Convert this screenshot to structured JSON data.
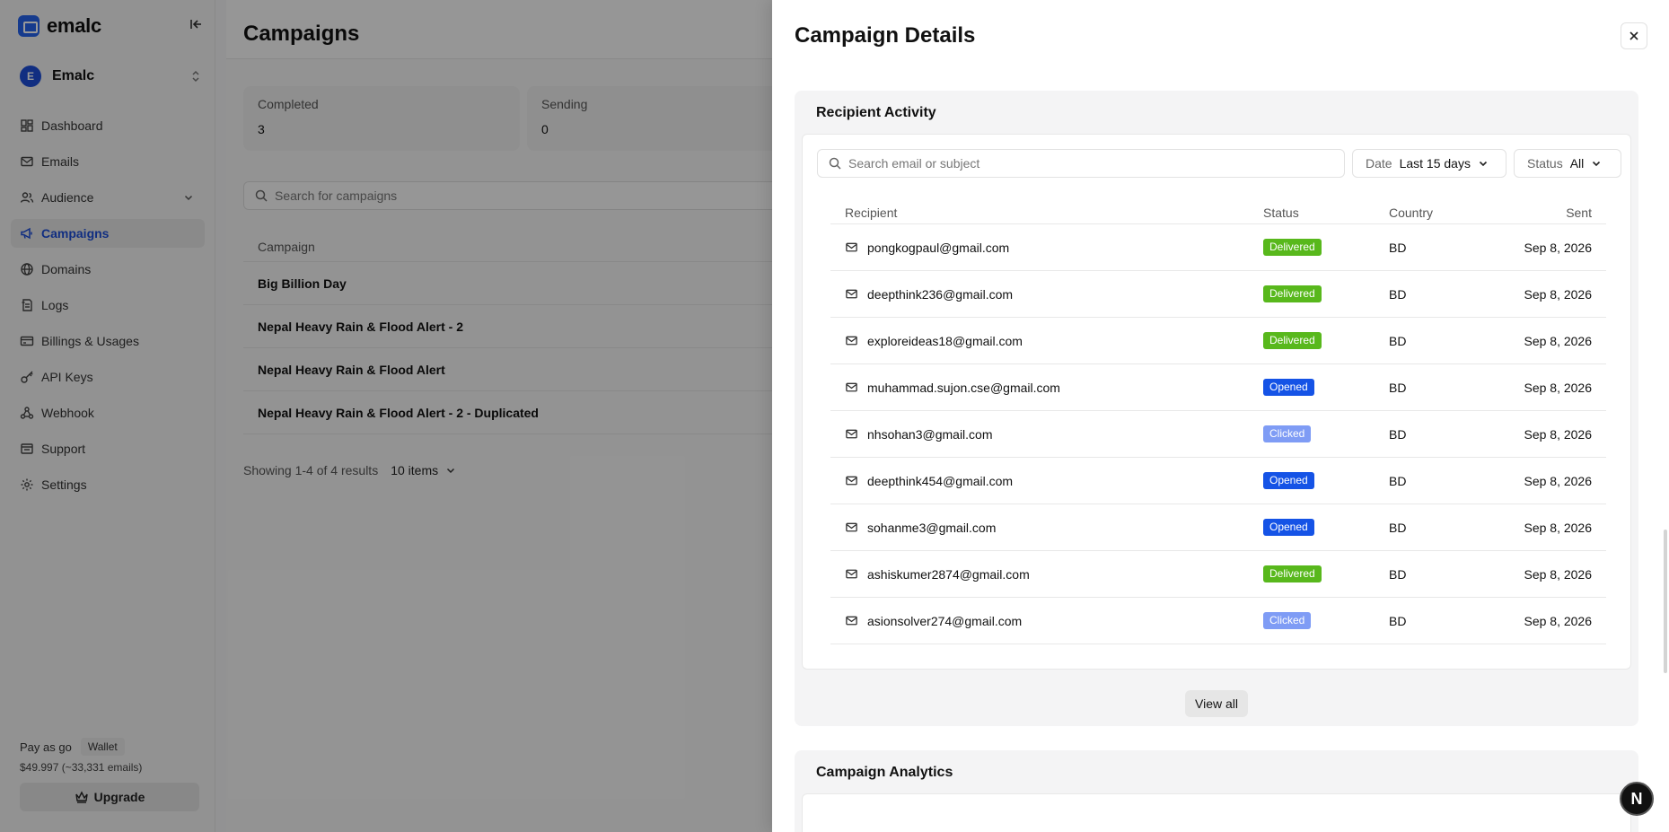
{
  "app": {
    "brand_name": "emalc",
    "org_name": "Emalc",
    "org_initial": "E"
  },
  "sidebar": {
    "items": [
      {
        "label": "Dashboard",
        "icon": "dashboard-icon"
      },
      {
        "label": "Emails",
        "icon": "mail-icon"
      },
      {
        "label": "Audience",
        "icon": "users-icon"
      },
      {
        "label": "Campaigns",
        "icon": "megaphone-icon",
        "active": true
      },
      {
        "label": "Domains",
        "icon": "globe-icon"
      },
      {
        "label": "Logs",
        "icon": "logs-icon"
      },
      {
        "label": "Billings & Usages",
        "icon": "credit-card-icon"
      },
      {
        "label": "API Keys",
        "icon": "key-icon"
      },
      {
        "label": "Webhook",
        "icon": "webhook-icon"
      },
      {
        "label": "Support",
        "icon": "support-icon"
      },
      {
        "label": "Settings",
        "icon": "gear-icon"
      }
    ],
    "plan_label": "Pay as go",
    "wallet_label": "Wallet",
    "balance": "$49.997 (~33,331 emails)",
    "upgrade_label": "Upgrade"
  },
  "main": {
    "title": "Campaigns",
    "stats": [
      {
        "label": "Completed",
        "value": "3"
      },
      {
        "label": "Sending",
        "value": "0"
      }
    ],
    "search_placeholder": "Search for campaigns",
    "table_header": "Campaign",
    "campaigns": [
      "Big Billion Day",
      "Nepal Heavy Rain & Flood Alert - 2",
      "Nepal Heavy Rain & Flood Alert",
      "Nepal Heavy Rain & Flood Alert - 2 - Duplicated"
    ],
    "showing": "Showing 1-4 of 4 results",
    "page_size": "10 items"
  },
  "drawer": {
    "title": "Campaign Details",
    "activity": {
      "title": "Recipient Activity",
      "search_placeholder": "Search email or subject",
      "date_label": "Date",
      "date_value": "Last 15 days",
      "status_label": "Status",
      "status_value": "All",
      "columns": {
        "recipient": "Recipient",
        "status": "Status",
        "country": "Country",
        "sent": "Sent"
      },
      "rows": [
        {
          "email": "pongkogpaul@gmail.com",
          "status": "Delivered",
          "country": "BD",
          "sent": "Sep 8, 2026"
        },
        {
          "email": "deepthink236@gmail.com",
          "status": "Delivered",
          "country": "BD",
          "sent": "Sep 8, 2026"
        },
        {
          "email": "exploreideas18@gmail.com",
          "status": "Delivered",
          "country": "BD",
          "sent": "Sep 8, 2026"
        },
        {
          "email": "muhammad.sujon.cse@gmail.com",
          "status": "Opened",
          "country": "BD",
          "sent": "Sep 8, 2026"
        },
        {
          "email": "nhsohan3@gmail.com",
          "status": "Clicked",
          "country": "BD",
          "sent": "Sep 8, 2026"
        },
        {
          "email": "deepthink454@gmail.com",
          "status": "Opened",
          "country": "BD",
          "sent": "Sep 8, 2026"
        },
        {
          "email": "sohanme3@gmail.com",
          "status": "Opened",
          "country": "BD",
          "sent": "Sep 8, 2026"
        },
        {
          "email": "ashiskumer2874@gmail.com",
          "status": "Delivered",
          "country": "BD",
          "sent": "Sep 8, 2026"
        },
        {
          "email": "asionsolver274@gmail.com",
          "status": "Clicked",
          "country": "BD",
          "sent": "Sep 8, 2026"
        }
      ],
      "view_all_label": "View all"
    },
    "analytics_title": "Campaign Analytics"
  },
  "status_colors": {
    "Delivered": "#58b81c",
    "Opened": "#1553e6",
    "Clicked": "#7f9cf5"
  },
  "accent_color": "#1d4ed8",
  "fab_label": "N"
}
